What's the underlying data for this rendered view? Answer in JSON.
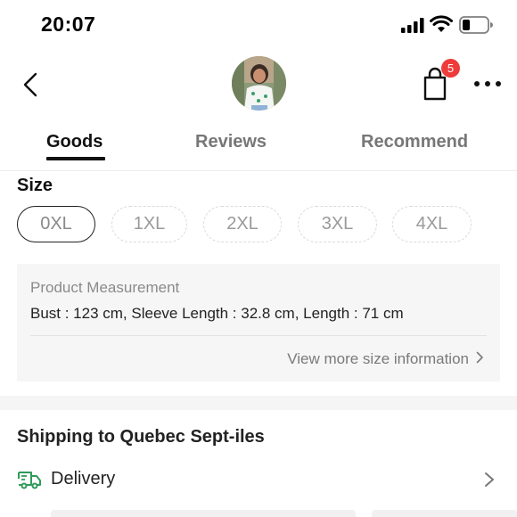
{
  "status_bar": {
    "time": "20:07",
    "icons": [
      "signal-icon",
      "wifi-icon",
      "battery-icon"
    ]
  },
  "header": {
    "avatar": "seller-avatar",
    "cart_badge_count": "5",
    "icons": [
      "back-arrow-icon",
      "shopping-bag-icon",
      "more-dots-icon"
    ]
  },
  "tabs": [
    {
      "label": "Goods",
      "active": true
    },
    {
      "label": "Reviews",
      "active": false
    },
    {
      "label": "Recommend",
      "active": false
    }
  ],
  "size": {
    "title": "Size",
    "options": [
      {
        "label": "0XL",
        "selected": true
      },
      {
        "label": "1XL",
        "selected": false
      },
      {
        "label": "2XL",
        "selected": false
      },
      {
        "label": "3XL",
        "selected": false
      },
      {
        "label": "4XL",
        "selected": false
      }
    ]
  },
  "measurement": {
    "title": "Product Measurement",
    "values_text": "Bust : 123 cm,  Sleeve Length : 32.8 cm,  Length : 71 cm",
    "view_more_label": "View more size information"
  },
  "shipping": {
    "title": "Shipping to Quebec Sept-iles",
    "delivery_label": "Delivery"
  },
  "colors": {
    "accent_green": "#2f9a5a",
    "badge_red": "#ee3b3b",
    "active_text": "#111111",
    "muted_text": "#777777"
  }
}
